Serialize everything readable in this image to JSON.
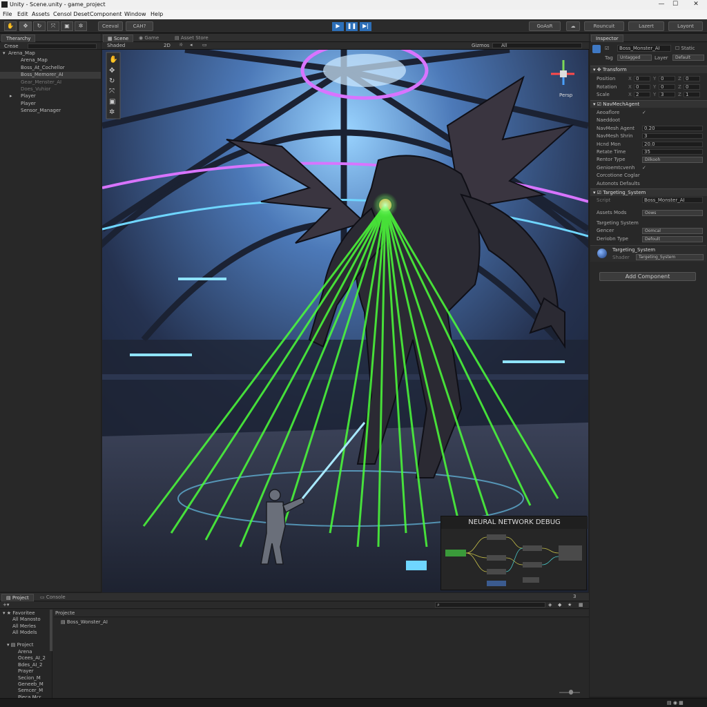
{
  "window": {
    "title": "Unity - Scene.unity - game_project"
  },
  "menu": [
    "File",
    "Edit",
    "Assets",
    "Censol Deset",
    "Component",
    "Window",
    "Help"
  ],
  "toolbar": {
    "center_left": "Ceeval",
    "center_right": "CAH?",
    "right_items": [
      "GoAsR",
      "Rouncuit",
      "Lazert",
      "Layont"
    ]
  },
  "hierarchy": {
    "tab": "Therarchy",
    "search": "Creae",
    "items": [
      {
        "label": "Arena_Map",
        "indent": 0,
        "arrow": "v"
      },
      {
        "label": "Arena_Map",
        "indent": 1,
        "arrow": ""
      },
      {
        "label": "Boss_At_Cochellor",
        "indent": 1,
        "arrow": ""
      },
      {
        "label": "Boss_Memorer_AI",
        "indent": 1,
        "arrow": "",
        "selected": true
      },
      {
        "label": "Gear_Menster_AI",
        "indent": 1,
        "arrow": "",
        "dim": true
      },
      {
        "label": "Does_Vuhior",
        "indent": 1,
        "arrow": "",
        "dim": true
      },
      {
        "label": "Player",
        "indent": 1,
        "arrow": ">"
      },
      {
        "label": "Player",
        "indent": 1,
        "arrow": ""
      },
      {
        "label": "Sensor_Manager",
        "indent": 1,
        "arrow": ""
      }
    ]
  },
  "scene_tabs": {
    "scene": "Scene",
    "game": "Game",
    "asset_store": "Asset Store",
    "shaded": "Shaded",
    "twod": "2D",
    "gizmos": "Gizmos",
    "all": "All"
  },
  "gizmo_label": "Persp",
  "nn_debug": {
    "title": "NEURAL NETWORK DEBUG"
  },
  "inspector": {
    "tab": "Inspector",
    "object_name": "Boss_Monster_AI",
    "static": "Static",
    "tag_label": "Tag",
    "tag": "Untagged",
    "layer_label": "Layer",
    "layer": "Default",
    "transform": {
      "title": "Transform",
      "rows": [
        {
          "label": "Position",
          "x": "0",
          "y": "0",
          "z": "0"
        },
        {
          "label": "Rotation",
          "x": "0",
          "y": "0",
          "z": "0"
        },
        {
          "label": "Scale",
          "x": "2",
          "y": "3",
          "z": "1"
        }
      ]
    },
    "navmesh": {
      "title": "NavMechAgent",
      "rows": [
        {
          "label": "Aeoaflore",
          "value": "✓"
        },
        {
          "label": "Naeddoot",
          "value": ""
        },
        {
          "label": "NavMesh Agent",
          "value": "0.20"
        },
        {
          "label": "NavMesh Shrin",
          "value": "3"
        },
        {
          "label": "Hcnd Mon",
          "value": "20.0"
        },
        {
          "label": "Retate Time",
          "value": "35"
        },
        {
          "label": "Rentor Type",
          "value": "Dilkooh"
        },
        {
          "label": "Genioemtcvenh",
          "value": "✓"
        },
        {
          "label": "Corcotione Coglar",
          "value": ""
        },
        {
          "label": "Autonots Defaults",
          "value": ""
        }
      ]
    },
    "targeting": {
      "title": "Targeting_System",
      "script_label": "Script",
      "script": "Boss_Monster_AI",
      "rows": [
        {
          "label": "Assets Mods",
          "value": "Oows"
        },
        {
          "label": "Targeting System",
          "value": ""
        },
        {
          "label": "Gencer",
          "value": "Oomcal"
        },
        {
          "label": "Deriobn Type",
          "value": "Defoult"
        }
      ]
    },
    "material": {
      "title": "Targeting_System",
      "shader_label": "Shader",
      "shader": "Targeting_System"
    },
    "add_component": "Add Component"
  },
  "project": {
    "tabs": [
      "Project",
      "Console"
    ],
    "crumb": "Projecte",
    "file": "Boss_Wonster_AI",
    "count": "3",
    "favorites": {
      "title": "Favoritee",
      "items": [
        "All Manosto",
        "All Merles",
        "All Models"
      ]
    },
    "tree": {
      "title": "Project",
      "items": [
        "Arena",
        "Ocees_AI_2",
        "Bdes_AI_2",
        "Prayer",
        "Secion_M",
        "Geneeb_M",
        "Semcer_M",
        "Pieca Mcr"
      ]
    }
  },
  "colors": {
    "accent": "#2d6fb8",
    "laser": "#4cff3a",
    "panel": "#282828"
  }
}
